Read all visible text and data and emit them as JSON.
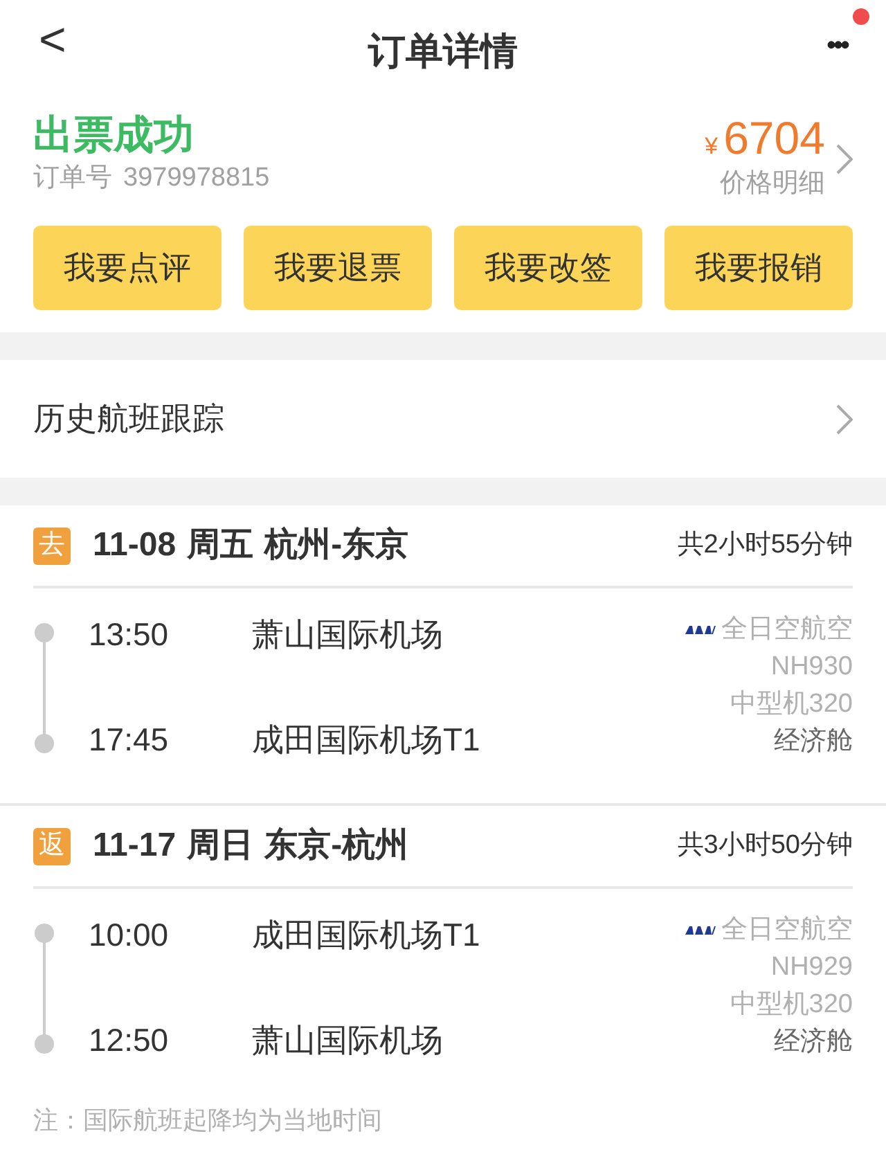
{
  "header": {
    "back": "<",
    "title": "订单详情",
    "more": "•••",
    "notification_dot": true
  },
  "order": {
    "status": "出票成功",
    "order_no_label": "订单号",
    "order_no": "3979978815",
    "currency": "¥",
    "price": "6704",
    "price_detail": "价格明细"
  },
  "actions": [
    "我要点评",
    "我要退票",
    "我要改签",
    "我要报销"
  ],
  "history": {
    "label": "历史航班跟踪"
  },
  "flights": [
    {
      "tag": "去",
      "date": "11-08",
      "weekday": "周五",
      "route": "杭州-东京",
      "duration": "共2小时55分钟",
      "depart_time": "13:50",
      "depart_airport": "萧山国际机场",
      "arrive_time": "17:45",
      "arrive_airport": "成田国际机场T1",
      "airline": "全日空航空",
      "flight_no": "NH930",
      "aircraft": "中型机320",
      "cabin": "经济舱"
    },
    {
      "tag": "返",
      "date": "11-17",
      "weekday": "周日",
      "route": "东京-杭州",
      "duration": "共3小时50分钟",
      "depart_time": "10:00",
      "depart_airport": "成田国际机场T1",
      "arrive_time": "12:50",
      "arrive_airport": "萧山国际机场",
      "airline": "全日空航空",
      "flight_no": "NH929",
      "aircraft": "中型机320",
      "cabin": "经济舱"
    }
  ],
  "note": "注：国际航班起降均为当地时间"
}
